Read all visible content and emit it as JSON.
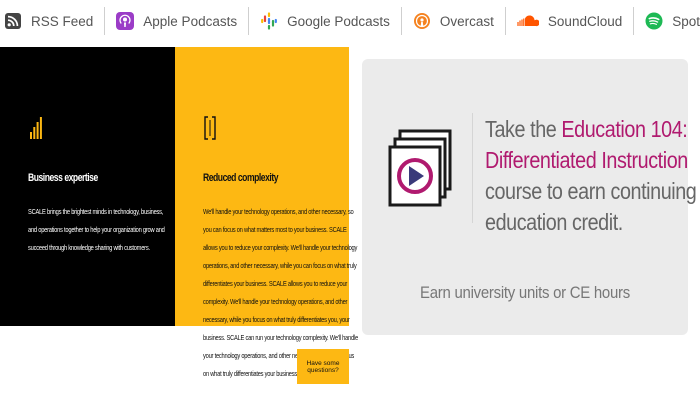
{
  "podcast_links": [
    {
      "label": "RSS Feed",
      "icon": "rss-icon",
      "color": "#444444"
    },
    {
      "label": "Apple Podcasts",
      "icon": "apple-podcasts-icon",
      "color": "#9b3cc7"
    },
    {
      "label": "Google Podcasts",
      "icon": "google-podcasts-icon",
      "color": "#4285f4"
    },
    {
      "label": "Overcast",
      "icon": "overcast-icon",
      "color": "#f5821f"
    },
    {
      "label": "SoundCloud",
      "icon": "soundcloud-icon",
      "color": "#ff5500"
    },
    {
      "label": "Spotify",
      "icon": "spotify-icon",
      "color": "#1db954"
    }
  ],
  "features": [
    {
      "title": "Business expertise",
      "icon": "bar-chart-icon",
      "body": "SCALE brings the brightest minds in technology, business, and operations together to help your organization grow and succeed through knowledge sharing with customers."
    },
    {
      "title": "Reduced complexity",
      "icon": "bracket-icon",
      "body": "We'll handle your technology operations, and other necessary, so you can focus on what matters most to your business. SCALE allows you to reduce your complexity. We'll handle your technology operations, and other necessary, while you can focus on what truly differentiates your business. SCALE allows you to reduce your complexity. We'll handle your technology operations, and other necessary, while you focus on what truly differentiates you, your business. SCALE can run your technology complexity. We'll handle your technology operations, and other necessary, while you focus on what truly differentiates your business."
    }
  ],
  "mini_cta": "Have some questions?",
  "course_card": {
    "prefix": "Take the ",
    "highlight": "Education 104: Differentiated Instruction",
    "suffix": "course to earn continuing education credit.",
    "link": "Earn university units or CE hours",
    "accent": "#b01a6f"
  },
  "colors": {
    "black_panel": "#000000",
    "gold_panel": "#fdb813",
    "card_bg": "#ebebeb"
  }
}
